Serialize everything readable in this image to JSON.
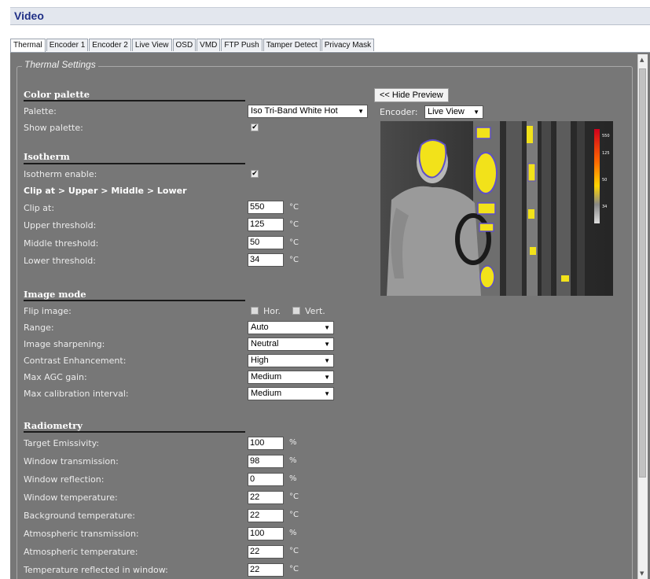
{
  "window_title": "Video",
  "tabs": [
    {
      "label": "Thermal",
      "active": true
    },
    {
      "label": "Encoder 1",
      "active": false
    },
    {
      "label": "Encoder 2",
      "active": false
    },
    {
      "label": "Live View",
      "active": false
    },
    {
      "label": "OSD",
      "active": false
    },
    {
      "label": "VMD",
      "active": false
    },
    {
      "label": "FTP Push",
      "active": false
    },
    {
      "label": "Tamper Detect",
      "active": false
    },
    {
      "label": "Privacy Mask",
      "active": false
    }
  ],
  "fieldset_legend": "Thermal Settings",
  "color_palette": {
    "heading": "Color palette",
    "palette_label": "Palette:",
    "palette_value": "Iso Tri-Band White Hot",
    "show_palette_label": "Show palette:",
    "show_palette_checked": true
  },
  "isotherm": {
    "heading": "Isotherm",
    "enable_label": "Isotherm enable:",
    "enable_checked": true,
    "clip_order_label": "Clip at > Upper > Middle > Lower",
    "clip_label": "Clip at:",
    "clip_value": "550",
    "upper_label": "Upper threshold:",
    "upper_value": "125",
    "middle_label": "Middle threshold:",
    "middle_value": "50",
    "lower_label": "Lower threshold:",
    "lower_value": "34",
    "unit": "°C"
  },
  "image_mode": {
    "heading": "Image mode",
    "flip_label": "Flip image:",
    "flip_hor_label": "Hor.",
    "flip_vert_label": "Vert.",
    "flip_hor_checked": false,
    "flip_vert_checked": false,
    "range_label": "Range:",
    "range_value": "Auto",
    "sharpening_label": "Image sharpening:",
    "sharpening_value": "Neutral",
    "contrast_label": "Contrast Enhancement:",
    "contrast_value": "High",
    "agc_label": "Max AGC gain:",
    "agc_value": "Medium",
    "calibration_label": "Max calibration interval:",
    "calibration_value": "Medium"
  },
  "radiometry": {
    "heading": "Radiometry",
    "emissivity_label": "Target Emissivity:",
    "emissivity_value": "100",
    "win_trans_label": "Window transmission:",
    "win_trans_value": "98",
    "win_refl_label": "Window reflection:",
    "win_refl_value": "0",
    "win_temp_label": "Window temperature:",
    "win_temp_value": "22",
    "bg_temp_label": "Background temperature:",
    "bg_temp_value": "22",
    "atm_trans_label": "Atmospheric transmission:",
    "atm_trans_value": "100",
    "atm_temp_label": "Atmospheric temperature:",
    "atm_temp_value": "22",
    "refl_win_label": "Temperature reflected in window:",
    "refl_win_value": "22",
    "unit_pct": "%",
    "unit_c": "°C"
  },
  "preview": {
    "hide_button": "<< Hide Preview",
    "encoder_label": "Encoder:",
    "encoder_value": "Live View",
    "scale_labels": [
      "550",
      "125",
      "50",
      "34"
    ]
  },
  "colors": {
    "panel_bg": "#777777",
    "title_text": "#1f2f86",
    "iso_yellow": "#f2e21a",
    "iso_purple": "#5d4fc8"
  }
}
